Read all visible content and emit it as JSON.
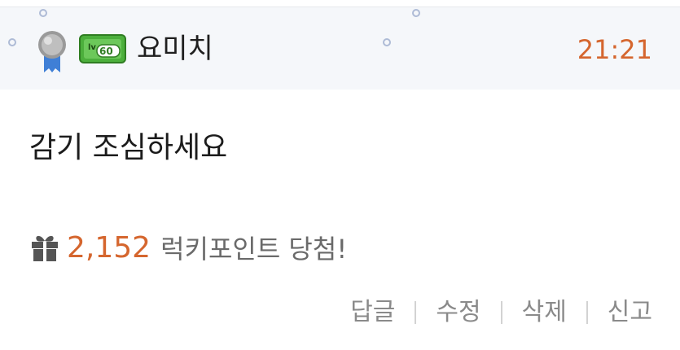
{
  "comment": {
    "username": "요미치",
    "level_badge": "lv60",
    "timestamp": "21:21",
    "body": "감기 조심하세요",
    "lucky_points": {
      "value": "2,152",
      "label": "럭키포인트 당첨!"
    },
    "actions": [
      "답글",
      "수정",
      "삭제",
      "신고"
    ]
  },
  "icons": {
    "rank": "medal-icon",
    "level": "level-badge-icon",
    "gift": "gift-icon"
  },
  "colors": {
    "accent": "#d5662e",
    "header_bg": "#f5f7fa",
    "level_badge": "#4caf3c",
    "action_text": "#8a8a8a"
  }
}
